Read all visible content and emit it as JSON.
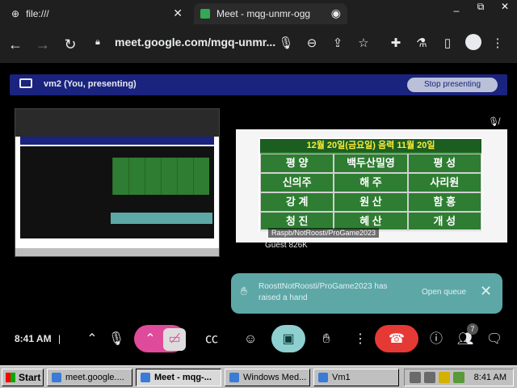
{
  "browser": {
    "tabs": [
      {
        "title": "file:///"
      },
      {
        "title": "Meet - mqg-unmr-ogg"
      }
    ],
    "address": "meet.google.com/mgq-unmr...",
    "window_controls": {
      "min": "_",
      "max": "⧉",
      "close": "✕"
    }
  },
  "meet": {
    "presenting_label": "vm2 (You, presenting)",
    "stop_label": "Stop presenting",
    "participant": {
      "name": "Guest 826K"
    },
    "board": {
      "header": "12월 20일(금요일) 음력 11월 20일",
      "rows": [
        [
          "평 양",
          "백두산밀영",
          "평 성"
        ],
        [
          "신의주",
          "해 주",
          "사리원"
        ],
        [
          "강 계",
          "원 산",
          "함 흥"
        ],
        [
          "청 진",
          "혜 산",
          "개 성"
        ]
      ],
      "caption": "Raspb/NotRoosti/ProGame2023"
    },
    "notification": {
      "text": "RoosttNotRoosti/ProGame2023 has raised a hand",
      "action": "Open queue"
    },
    "controls": {
      "time": "8:41 AM",
      "people_count": "7"
    }
  },
  "taskbar": {
    "start_label": "Start",
    "tasks": [
      {
        "label": "meet.google...."
      },
      {
        "label": "Meet - mqg-..."
      },
      {
        "label": "Windows Med..."
      },
      {
        "label": "Vm1"
      }
    ],
    "clock": "8:41 AM"
  },
  "colors": {
    "present_bar": "#1a237e",
    "notification": "#5da7a7",
    "end_call": "#e53935",
    "board_green": "#2e7d32"
  }
}
